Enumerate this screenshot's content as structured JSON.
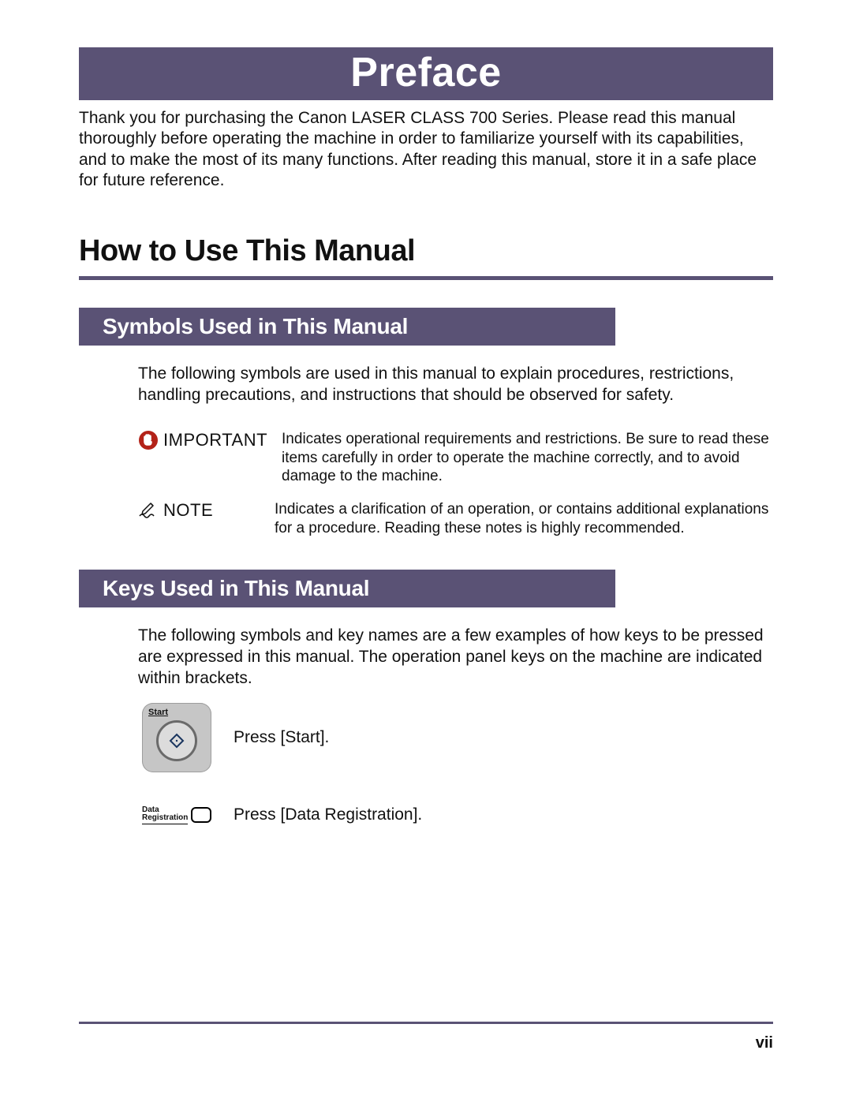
{
  "title": "Preface",
  "intro": "Thank you for purchasing the Canon LASER CLASS 700 Series. Please read this manual thoroughly before operating the machine in order to familiarize yourself with its capabilities, and to make the most of its many functions. After reading this manual, store it in a safe place for future reference.",
  "section": {
    "heading": "How to Use This Manual"
  },
  "symbols": {
    "heading": "Symbols Used in This Manual",
    "intro": "The following symbols are used in this manual to explain procedures, restrictions, handling precautions, and instructions that should be observed for safety.",
    "important": {
      "label": "IMPORTANT",
      "desc": "Indicates operational requirements and restrictions. Be sure to read these items carefully in order to operate the machine correctly, and to avoid damage to the machine."
    },
    "note": {
      "label": "NOTE",
      "desc": "Indicates a clarification of an operation, or contains additional explanations for a procedure. Reading these notes is highly recommended."
    }
  },
  "keys": {
    "heading": "Keys Used in This Manual",
    "intro": "The following symbols and key names are a few examples of how keys to be pressed are expressed in this manual. The operation panel keys on the machine are indicated within brackets.",
    "start": {
      "key_label": "Start",
      "text": "Press [Start]."
    },
    "datareg": {
      "key_label": "Data\nRegistration",
      "text": "Press [Data Registration]."
    }
  },
  "page_number": "vii"
}
